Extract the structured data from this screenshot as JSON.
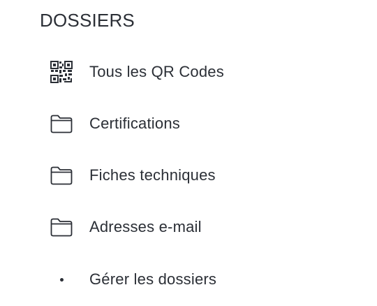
{
  "section": {
    "title": "DOSSIERS"
  },
  "items": [
    {
      "label": "Tous les QR Codes",
      "icon": "qr-code-icon"
    },
    {
      "label": "Certifications",
      "icon": "folder-icon"
    },
    {
      "label": "Fiches techniques",
      "icon": "folder-icon"
    },
    {
      "label": "Adresses e-mail",
      "icon": "folder-icon"
    },
    {
      "label": "Gérer les dossiers",
      "icon": "bullet-icon"
    }
  ]
}
